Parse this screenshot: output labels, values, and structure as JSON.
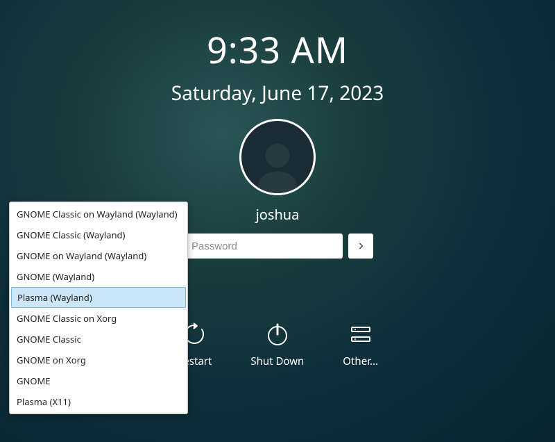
{
  "clock": {
    "time": "9:33 AM",
    "date": "Saturday, June 17, 2023"
  },
  "user": {
    "name": "joshua"
  },
  "password": {
    "placeholder": "Password"
  },
  "actions": {
    "restart": "Restart",
    "shutdown": "Shut Down",
    "other": "Other..."
  },
  "sessions": {
    "items": [
      "GNOME Classic on Wayland (Wayland)",
      "GNOME Classic (Wayland)",
      "GNOME on Wayland (Wayland)",
      "GNOME (Wayland)",
      "Plasma (Wayland)",
      "GNOME Classic on Xorg",
      "GNOME Classic",
      "GNOME on Xorg",
      "GNOME",
      "Plasma (X11)"
    ],
    "selected_index": 4
  }
}
